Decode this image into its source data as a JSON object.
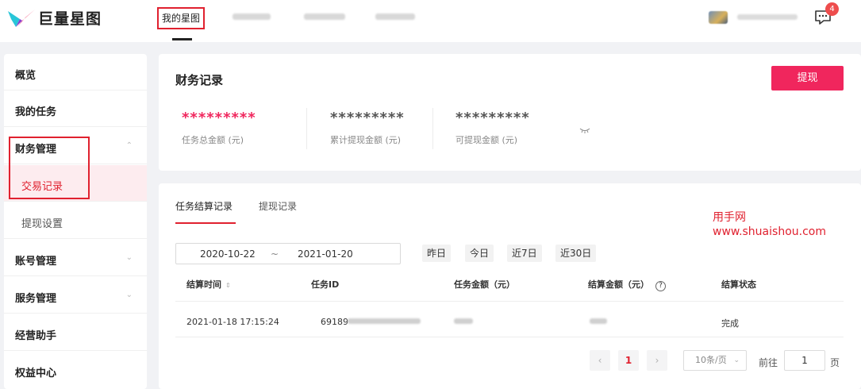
{
  "header": {
    "logo_text": "巨量星图",
    "nav_active": "我的星图",
    "message_badge": "4"
  },
  "sidebar": {
    "items": [
      {
        "label": "概览"
      },
      {
        "label": "我的任务"
      },
      {
        "label": "财务管理",
        "chevron": "⌃"
      },
      {
        "label": "交易记录"
      },
      {
        "label": "提现设置"
      },
      {
        "label": "账号管理",
        "chevron": "⌄"
      },
      {
        "label": "服务管理",
        "chevron": "⌄"
      },
      {
        "label": "经营助手"
      },
      {
        "label": "权益中心"
      }
    ]
  },
  "finance": {
    "title": "财务记录",
    "withdraw_button": "提现",
    "stats": [
      {
        "value": "*********",
        "label": "任务总金额 (元)",
        "color": "#f0265d"
      },
      {
        "value": "*********",
        "label": "累计提现金额 (元)",
        "color": "#555555"
      },
      {
        "value": "*********",
        "label": "可提现金额 (元)",
        "color": "#555555"
      }
    ],
    "eye_icon": "closed-eye-icon"
  },
  "records": {
    "tabs": [
      "任务结算记录",
      "提现记录"
    ],
    "date_start": "2020-10-22",
    "date_sep": "~",
    "date_end": "2021-01-20",
    "quick_ranges": [
      "昨日",
      "今日",
      "近7日",
      "近30日"
    ],
    "columns": [
      "结算时间",
      "任务ID",
      "任务金额（元）",
      "结算金额（元）",
      "结算状态"
    ],
    "sort_icon": "⇕",
    "help_icon": "?",
    "rows": [
      {
        "time": "2021-01-18 17:15:24",
        "task_id_prefix": "69189",
        "status": "完成"
      }
    ],
    "pagination": {
      "prev": "‹",
      "current": "1",
      "next": "›",
      "page_size": "10条/页",
      "goto_label": "前往",
      "goto_value": "1",
      "page_suffix": "页"
    }
  },
  "watermark": {
    "line1": "用手网",
    "line2": "www.shuaishou.com"
  }
}
